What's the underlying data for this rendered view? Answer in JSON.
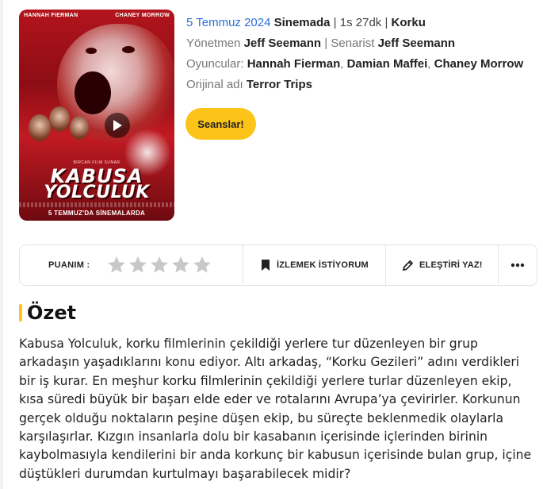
{
  "poster": {
    "cast_top_left": "HANNAH FIERMAN",
    "cast_top_right": "CHANEY MORROW",
    "credit_line": "BIRCAN FILM SUNAR",
    "title_line1": "KABUSA",
    "title_line2": "YOLCULUK",
    "release_line": "5 TEMMUZ'DA SİNEMALARDA",
    "play_icon": "play-icon"
  },
  "info": {
    "date": "5 Temmuz 2024",
    "status": "Sinemada",
    "separator": "|",
    "duration": "1s 27dk",
    "genre": "Korku",
    "director_label": "Yönetmen",
    "director": "Jeff Seemann",
    "writer_label": "Senarist",
    "writer": "Jeff Seemann",
    "cast_label": "Oyuncular:",
    "cast": [
      "Hannah Fierman",
      "Damian Maffei",
      "Chaney Morrow"
    ],
    "original_title_label": "Orijinal adı",
    "original_title": "Terror Trips"
  },
  "sessions_button": "Seanslar!",
  "actions": {
    "rating_label": "PUANIM :",
    "rating_stars": 5,
    "rating_value": 0,
    "watchlist_label": "İZLEMEK İSTİYORUM",
    "review_label": "ELEŞTİRİ YAZ!",
    "more_label": "•••"
  },
  "summary": {
    "title": "Özet",
    "text": "Kabusa Yolculuk, korku filmlerinin çekildiği yerlere tur düzenleyen bir grup arkadaşın yaşadıklarını konu ediyor. Altı arkadaş, “Korku Gezileri” adını verdikleri bir iş kurar. En meşhur korku filmlerinin çekildiği yerlere turlar düzenleyen ekip, kısa süredi büyük bir başarı elde eder ve rotalarını Avrupa’ya çevirirler. Korkunun gerçek olduğu noktaların peşine düşen ekip, bu süreçte beklenmedik olaylarla karşılaşırlar. Kızgın insanlarla dolu bir kasabanın içerisinde içlerinden birinin kaybolmasıyla kendilerini bir anda korkunç bir kabusun içerisinde bulan grup, içine düştükleri durumdan kurtulmayı başarabilecek midir?"
  },
  "colors": {
    "accent": "#fcc419",
    "link_blue": "#2e6fd8",
    "poster_red": "#b3141d",
    "star_gray": "#c8c8c8"
  }
}
